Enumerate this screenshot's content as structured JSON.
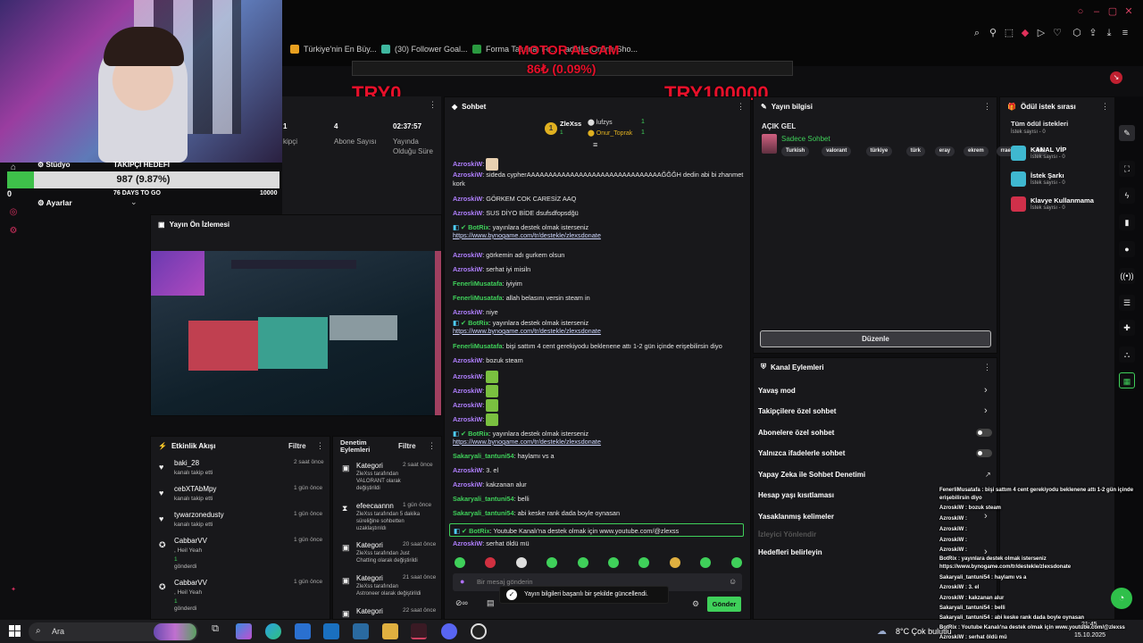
{
  "browser": {
    "bookmarks": [
      "Türkiye'nin En Büy...",
      "(30) Follower Goal...",
      "Forma Tasarla, Fo...",
      "adidas Online Sho..."
    ]
  },
  "overlay": {
    "motor_title": "MOTOR ALCAM",
    "motor_value": "86₺ (0.09%)",
    "left_amount": "TRY0",
    "right_amount": "TRY100000"
  },
  "webcam": {
    "studio_label": "Stüdyo",
    "goal_title": "TAKİPÇİ HEDEFİ",
    "goal_value": "987 (9.87%)",
    "goal_progress": 0.0987,
    "goal_min": "0",
    "goal_days": "76 DAYS TO GO",
    "goal_max": "10000",
    "settings_label": "Ayarlar"
  },
  "stats": [
    {
      "value": "1",
      "label": "kipçi"
    },
    {
      "value": "4",
      "label": "Abone Sayısı"
    },
    {
      "value": "02:37:57",
      "label": "Yayında Olduğu Süre"
    }
  ],
  "preview": {
    "title": "Yayın Ön İzlemesi"
  },
  "activity": {
    "title": "Etkinlik Akışı",
    "filter": "Filtre",
    "items": [
      {
        "name": "baki_28",
        "sub": "kanalı takip etti",
        "time": "2 saat önce"
      },
      {
        "name": "cebXTAbMpy",
        "sub": "kanalı takip etti",
        "time": "1 gün önce"
      },
      {
        "name": "tywarzonedusty",
        "sub": "kanalı takip etti",
        "time": "1 gün önce"
      },
      {
        "name": "CabbarVV",
        "sub": ", Heil Yeah",
        "extra": "1",
        "sub2": "gönderdi",
        "time": "1 gün önce"
      },
      {
        "name": "CabbarVV",
        "sub": ", Heil Yeah",
        "extra": "1",
        "sub2": "gönderdi",
        "time": "1 gün önce"
      }
    ]
  },
  "moderation": {
    "title": "Denetim Eylemleri",
    "filter": "Filtre",
    "items": [
      {
        "name": "Kategori",
        "time": "2 saat önce",
        "l1": "ZleXss tarafından",
        "l2": "VALORANT olarak",
        "l3": "değiştirildi"
      },
      {
        "name": "efeecaannn",
        "time": "1 gün önce",
        "l1": "ZleXss tarafından 5 dakika",
        "l2": "süreliğine sohbetten",
        "l3": "uzaklaştırıldı"
      },
      {
        "name": "Kategori",
        "time": "20 saat önce",
        "l1": "ZleXss tarafından Just",
        "l2": "Chatting olarak değiştirildi",
        "l3": ""
      },
      {
        "name": "Kategori",
        "time": "21 saat önce",
        "l1": "ZleXss tarafından",
        "l2": "Astroneer olarak değiştirildi",
        "l3": ""
      },
      {
        "name": "Kategori",
        "time": "22 saat önce",
        "l1": "",
        "l2": "",
        "l3": ""
      }
    ]
  },
  "chat": {
    "title": "Sohbet",
    "top_user": "ZleXss",
    "top_user_count": "1",
    "leaders": [
      {
        "name": "lufzys",
        "count": "1"
      },
      {
        "name": "Onur_Toprak",
        "count": "1"
      }
    ],
    "messages": [
      {
        "user": "AzroskiW",
        "color": "p",
        "text": ":",
        "emote": true
      },
      {
        "user": "AzroskiW",
        "color": "p",
        "text": ": sideda cypherAAAAAAAAAAAAAAAAAAAAAAAAAAAAAAAĞĞĞH dedin abi bi zhanmet",
        "cont": "kork"
      },
      {
        "user": "AzroskiW",
        "color": "p",
        "text": ": GÖRKEM COK CARESİZ AAQ"
      },
      {
        "user": "AzroskiW",
        "color": "p",
        "text": ": SUS DİYO BİDE dsufsdfopsdğü"
      },
      {
        "user": "BotRix",
        "color": "g",
        "text": ": yayınlara destek olmak isterseniz",
        "link": "https://www.bynogame.com/tr/destekle/zlexsdonate"
      },
      {
        "user": "AzroskiW",
        "color": "p",
        "text": ": görkemin adı gurkem olsun"
      },
      {
        "user": "AzroskiW",
        "color": "p",
        "text": ": serhat iyi misiln"
      },
      {
        "user": "FenerliMusatafa",
        "color": "g",
        "text": ": iyiyim"
      },
      {
        "user": "FenerliMusatafa",
        "color": "g",
        "text": ": allah belasını versin steam in"
      },
      {
        "user": "AzroskiW",
        "color": "p",
        "text": ": niye"
      },
      {
        "user": "BotRix",
        "color": "g",
        "text": ": yayınlara destek olmak isterseniz",
        "link": "https://www.bynogame.com/tr/destekle/zlexsdonate"
      },
      {
        "user": "FenerliMusatafa",
        "color": "g",
        "text": ": bişi sattım 4 cent gerekiyodu beklenene attı 1-2 gün içinde erişebilirsin diyo"
      },
      {
        "user": "AzroskiW",
        "color": "p",
        "text": ": bozuk steam"
      },
      {
        "user": "AzroskiW",
        "color": "p",
        "text": ":",
        "emote": true
      },
      {
        "user": "AzroskiW",
        "color": "p",
        "text": ":",
        "emote": true
      },
      {
        "user": "AzroskiW",
        "color": "p",
        "text": ":",
        "emote": true
      },
      {
        "user": "AzroskiW",
        "color": "p",
        "text": ":",
        "emote": true
      },
      {
        "user": "BotRix",
        "color": "g",
        "text": ": yayınlara destek olmak isterseniz",
        "link": "https://www.bynogame.com/tr/destekle/zlexsdonate"
      },
      {
        "user": "Sakaryali_tantuni54",
        "color": "g",
        "text": ": haylamı vs a"
      },
      {
        "user": "AzroskiW",
        "color": "p",
        "text": ": 3. el"
      },
      {
        "user": "AzroskiW",
        "color": "p",
        "text": ": kakzanan alur"
      },
      {
        "user": "Sakaryali_tantuni54",
        "color": "g",
        "text": ": belli"
      },
      {
        "user": "Sakaryali_tantuni54",
        "color": "g",
        "text": ": abi keske rank dada boyle oynasan"
      },
      {
        "user": "BotRix",
        "color": "g",
        "text": ": Youtube Kanalı'na destek olmak için www.youtube.com/@zlexss",
        "highlight": true
      },
      {
        "user": "AzroskiW",
        "color": "p",
        "text": ": serhat öldü mü"
      }
    ],
    "input_placeholder": "Bir mesaj gönderin",
    "send_label": "Gönder",
    "toast": "Yayın bilgileri başarılı bir şekilde güncellendi."
  },
  "stream_info": {
    "title": "Yayın bilgisi",
    "status": "AÇIK GEL",
    "category": "Sadece Sohbet",
    "tags": [
      "Turkish",
      "valorant",
      "türkiye",
      "türk",
      "eray",
      "ekrem",
      "rraeme",
      "ek"
    ],
    "edit_label": "Düzenle"
  },
  "channel_actions": {
    "title": "Kanal Eylemleri",
    "items": [
      {
        "label": "Yavaş mod",
        "type": "arrow"
      },
      {
        "label": "Takipçilere özel sohbet",
        "type": "arrow"
      },
      {
        "label": "Abonelere özel sohbet",
        "type": "toggle"
      },
      {
        "label": "Yalnızca ifadelerle sohbet",
        "type": "toggle"
      },
      {
        "label": "Yapay Zeka ile Sohbet Denetimi",
        "type": "link"
      },
      {
        "label": "Hesap yaşı kısıtlaması",
        "type": "none"
      },
      {
        "label": "Yasaklanmış kelimeler",
        "type": "arrow"
      },
      {
        "label": "İzleyici Yönlendir",
        "type": "none"
      },
      {
        "label": "Hedefleri belirleyin",
        "type": "arrow"
      }
    ]
  },
  "rewards": {
    "title": "Ödül istek sırası",
    "all": "Tüm ödül istekleri",
    "all_sub": "İstek sayısı - 0",
    "items": [
      {
        "name": "KANAL VİP",
        "sub": "İstek sayısı - 0",
        "color": "#3fb8d0"
      },
      {
        "name": "İstek Şarkı",
        "sub": "İstek sayısı - 0",
        "color": "#3fb8d0"
      },
      {
        "name": "Klavye Kullanmama",
        "sub": "İstek sayısı - 0",
        "color": "#d0304a"
      }
    ]
  },
  "mini_chat": [
    "FenerliMusatafa : bişi sattım 4 cent gerekiyodu beklenene attı 1-2 gün içinde",
    "erişebilirsin diyo",
    "AzroskiW : bozuk steam",
    "AzroskiW :",
    "AzroskiW :",
    "AzroskiW :",
    "AzroskiW :",
    "BotRix : yayınlara destek olmak isterseniz",
    "https://www.bynogame.com/tr/destekle/zlexsdonate",
    "Sakaryali_tantuni54 : haylamı vs a",
    "AzroskiW : 3. el",
    "AzroskiW : kakzanan alur",
    "Sakaryali_tantuni54 : belli",
    "Sakaryali_tantuni54 : abi keske rank dada boyle oynasan",
    "BotRix : Youtube Kanalı'na destek olmak için www.youtube.com/@zlexss",
    "AzroskiW : serhat öldü mü"
  ],
  "taskbar": {
    "search": "Ara",
    "weather": "8°C  Çok bulutlu",
    "date": "15.10.2025",
    "time": "21:45"
  }
}
